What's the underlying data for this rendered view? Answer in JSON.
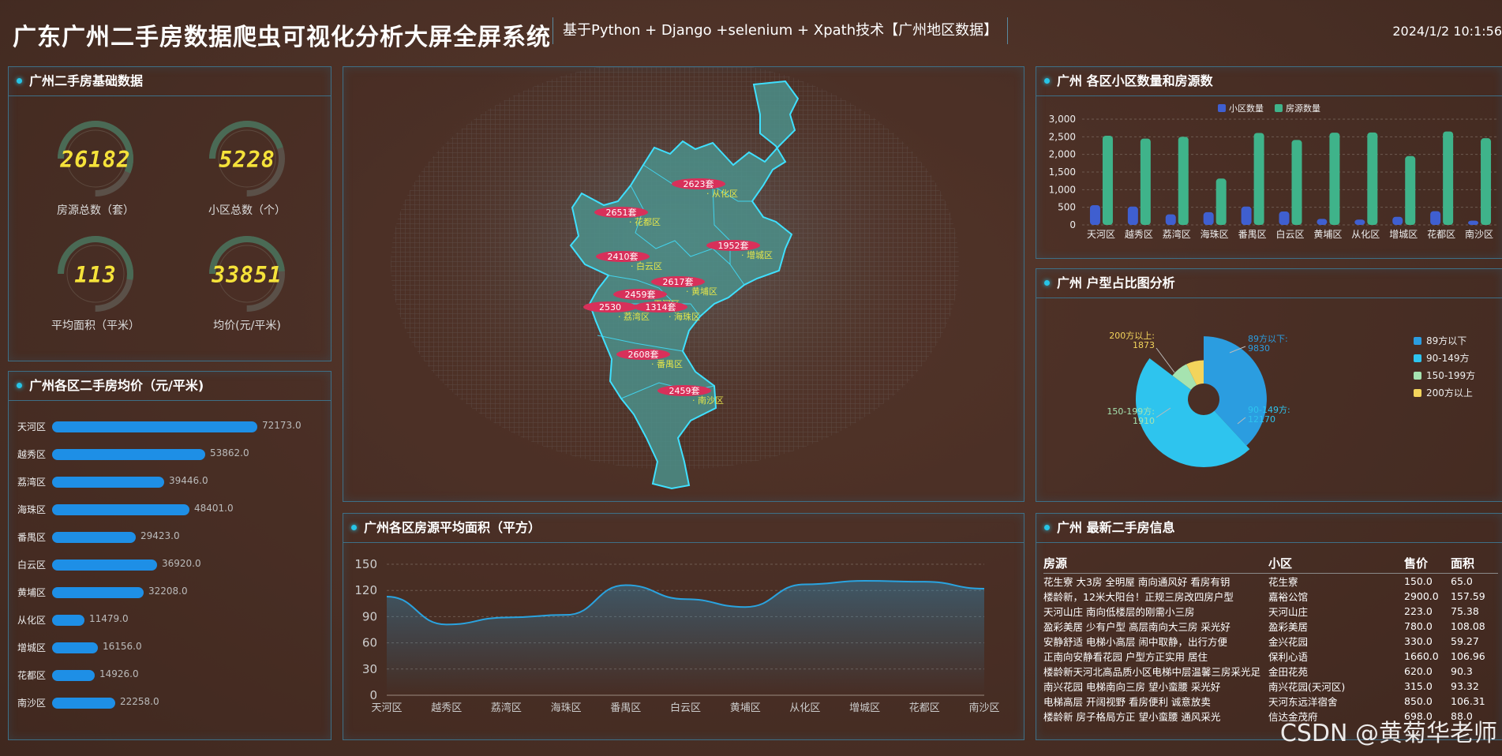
{
  "header": {
    "title": "广东广州二手房数据爬虫可视化分析大屏全屏系统",
    "subtitle": "基于Python + Django +selenium + Xpath技术【广州地区数据】",
    "datetime": "2024/1/2 10:1:56"
  },
  "basic": {
    "title": "广州二手房基础数据",
    "items": [
      {
        "value": "26182",
        "label": "房源总数（套）",
        "ratio": 0.75
      },
      {
        "value": "5228",
        "label": "小区总数（个）",
        "ratio": 0.6
      },
      {
        "value": "113",
        "label": "平均面积（平米）",
        "ratio": 0.7
      },
      {
        "value": "33851",
        "label": "均价(元/平米)",
        "ratio": 0.65
      }
    ]
  },
  "price": {
    "title": "广州各区二手房均价（元/平米)"
  },
  "map": {
    "labels": [
      {
        "count": "2623套",
        "district": "从化区"
      },
      {
        "count": "2651套",
        "district": "花都区"
      },
      {
        "count": "1952套",
        "district": "增城区"
      },
      {
        "count": "2410套",
        "district": "白云区"
      },
      {
        "count": "2617套",
        "district": "黄埔区"
      },
      {
        "count": "2459套",
        "district": "天河区"
      },
      {
        "count": "2530",
        "district": "荔湾区"
      },
      {
        "count": "1314套",
        "district": "海珠区"
      },
      {
        "count": "2608套",
        "district": "番禺区"
      },
      {
        "count": "2459套",
        "district": "南沙区"
      }
    ]
  },
  "area": {
    "title": "广州各区房源平均面积（平方）"
  },
  "count": {
    "title": "广州 各区小区数量和房源数"
  },
  "layout": {
    "title": "广州 户型占比图分析"
  },
  "latest": {
    "title": "广州 最新二手房信息",
    "headers": [
      "房源",
      "小区",
      "售价",
      "面积"
    ],
    "rows": [
      [
        "花生寮 大3房 全明屋 南向通风好 看房有钥",
        "花生寮",
        "150.0",
        "65.0"
      ],
      [
        "楼龄新，12米大阳台！正规三房改四房户型",
        "嘉裕公馆",
        "2900.0",
        "157.59"
      ],
      [
        "天河山庄 南向低楼层的刚需小三房",
        "天河山庄",
        "223.0",
        "75.38"
      ],
      [
        "盈彩美居 少有户型 高层南向大三房 采光好",
        "盈彩美居",
        "780.0",
        "108.08"
      ],
      [
        "安静舒适 电梯小高层 闹中取静，出行方便",
        "金兴花园",
        "330.0",
        "59.27"
      ],
      [
        "正南向安静看花园 户型方正实用 居住",
        "保利心语",
        "1660.0",
        "106.96"
      ],
      [
        "楼龄新天河北高品质小区电梯中层温馨三房采光足",
        "金田花苑",
        "620.0",
        "90.3"
      ],
      [
        "南兴花园 电梯南向三房 望小蛮腰 采光好",
        "南兴花园(天河区)",
        "315.0",
        "93.32"
      ],
      [
        "电梯高层 开阔视野 看房便利 诚意放卖",
        "天河东远洋宿舍",
        "850.0",
        "106.31"
      ],
      [
        "楼龄新 房子格局方正 望小蛮腰 通风采光",
        "信达金茂府",
        "698.0",
        "88.0"
      ]
    ]
  },
  "watermark": "CSDN @黄菊华老师",
  "colors": {
    "bar": "#1e8fe6",
    "community": "#3f5fd0",
    "listings": "#3fb38a",
    "line": "#2aa3df"
  },
  "chart_data": [
    {
      "type": "bar",
      "orientation": "horizontal",
      "title": "广州各区二手房均价（元/平米)",
      "categories": [
        "天河区",
        "越秀区",
        "荔湾区",
        "海珠区",
        "番禺区",
        "白云区",
        "黄埔区",
        "从化区",
        "增城区",
        "花都区",
        "南沙区"
      ],
      "values": [
        72173.0,
        53862.0,
        39446.0,
        48401.0,
        29423.0,
        36920.0,
        32208.0,
        11479.0,
        16156.0,
        14926.0,
        22258.0
      ],
      "value_labels": [
        "72173.0",
        "53862.0",
        "39446.0",
        "48401.0",
        "29423.0",
        "36920.0",
        "32208.0",
        "11479.0",
        "16156.0",
        "14926.0",
        "22258.0"
      ]
    },
    {
      "type": "area",
      "title": "广州各区房源平均面积（平方）",
      "categories": [
        "天河区",
        "越秀区",
        "荔湾区",
        "海珠区",
        "番禺区",
        "白云区",
        "黄埔区",
        "从化区",
        "增城区",
        "花都区",
        "南沙区"
      ],
      "values": [
        113,
        81,
        89,
        92,
        126,
        110,
        101,
        127,
        131,
        130,
        122
      ],
      "ylim": [
        0,
        150
      ],
      "yticks": [
        "0",
        "30",
        "60",
        "90",
        "120",
        "150"
      ]
    },
    {
      "type": "bar",
      "title": "广州 各区小区数量和房源数",
      "categories": [
        "天河区",
        "越秀区",
        "荔湾区",
        "海珠区",
        "番禺区",
        "白云区",
        "黄埔区",
        "从化区",
        "增城区",
        "花都区",
        "南沙区"
      ],
      "series": [
        {
          "name": "小区数量",
          "values": [
            560,
            520,
            300,
            360,
            520,
            380,
            170,
            150,
            230,
            390,
            120
          ]
        },
        {
          "name": "房源数量",
          "values": [
            2530,
            2450,
            2500,
            1314,
            2608,
            2410,
            2617,
            2623,
            1952,
            2651,
            2459
          ]
        }
      ],
      "ylim": [
        0,
        3000
      ],
      "yticks": [
        "0",
        "500",
        "1,000",
        "1,500",
        "2,000",
        "2,500",
        "3,000"
      ],
      "legend": "top"
    },
    {
      "type": "pie",
      "title": "广州 户型占比图分析",
      "categories": [
        "89方以下",
        "90-149方",
        "150-199方",
        "200方以上"
      ],
      "values": [
        9830,
        12170,
        1910,
        1873
      ],
      "labels": [
        {
          "name": "89方以下:",
          "value": "9830"
        },
        {
          "name": "90-149方:",
          "value": "12170"
        },
        {
          "name": "150-199方:",
          "value": "1910"
        },
        {
          "name": "200方以上:",
          "value": "1873"
        }
      ],
      "colors": [
        "#2b9de0",
        "#2ec4ee",
        "#a6e3b0",
        "#f3d45c"
      ],
      "legend": "right"
    }
  ]
}
